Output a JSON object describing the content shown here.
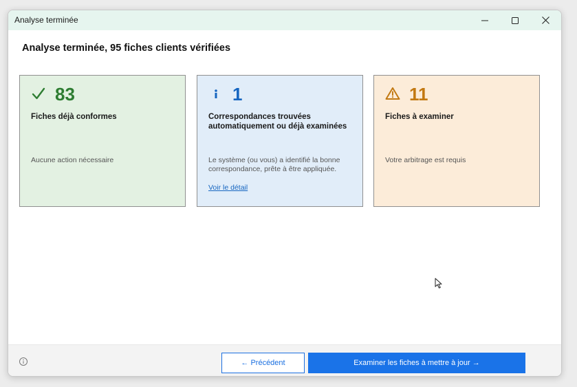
{
  "window": {
    "title": "Analyse terminée"
  },
  "heading": "Analyse terminée, 95 fiches clients vérifiées",
  "cards": [
    {
      "icon": "checkmark-icon",
      "count": "83",
      "label": "Fiches déjà conformes",
      "description": "Aucune action nécessaire",
      "color": "#2e7d32",
      "background": "#e3f1e2"
    },
    {
      "icon": "info-icon",
      "count": "1",
      "label": "Correspondances trouvées automatiquement ou déjà examinées",
      "description": "Le système (ou vous) a identifié la bonne correspondance, prête à être appliquée.",
      "link": "Voir le détail",
      "color": "#1565c0",
      "background": "#e1edf9"
    },
    {
      "icon": "warning-icon",
      "count": "11",
      "label": "Fiches à examiner",
      "description": "Votre arbitrage est requis",
      "color": "#c27912",
      "background": "#fcecd9"
    }
  ],
  "footer": {
    "prev_label": "← Précédent",
    "next_label": "Examiner les fiches à mettre à jour →",
    "accent": "#1a73e8"
  }
}
